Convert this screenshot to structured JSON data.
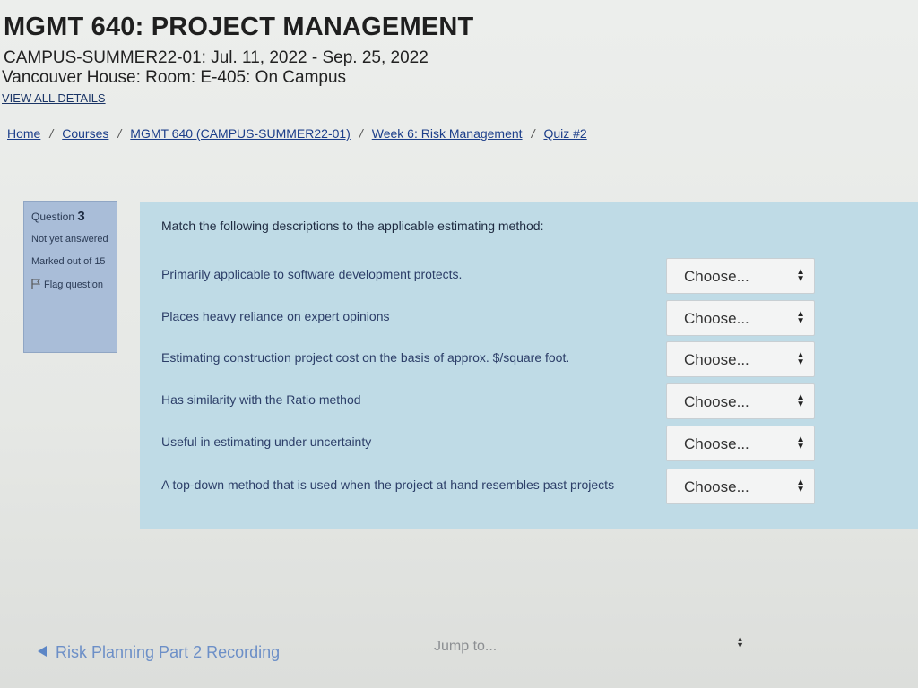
{
  "header": {
    "course_title": "MGMT 640: PROJECT MANAGEMENT",
    "session": "CAMPUS-SUMMER22-01: Jul. 11, 2022 - Sep. 25, 2022",
    "location": "Vancouver House: Room: E-405: On Campus",
    "view_details": "VIEW ALL DETAILS"
  },
  "breadcrumb": {
    "items": [
      "Home",
      "Courses",
      "MGMT 640 (CAMPUS-SUMMER22-01)",
      "Week 6: Risk Management",
      "Quiz #2"
    ],
    "separator": "/"
  },
  "question_info": {
    "label": "Question",
    "number": "3",
    "state": "Not yet answered",
    "grade": "Marked out of 15",
    "flag": "Flag question",
    "flag_icon": "flag-icon"
  },
  "question": {
    "prompt": "Match the following descriptions to the applicable estimating method:",
    "rows": [
      {
        "description": "Primarily applicable to software development protects.",
        "selected": "Choose..."
      },
      {
        "description": "Places heavy reliance on expert opinions",
        "selected": "Choose..."
      },
      {
        "description": "Estimating construction project cost on the basis of approx. $/square foot.",
        "selected": "Choose..."
      },
      {
        "description": "Has similarity with the Ratio method",
        "selected": "Choose..."
      },
      {
        "description": "Useful in estimating under uncertainty",
        "selected": "Choose..."
      },
      {
        "description": "A top-down method that is used when the project at hand resembles past projects",
        "selected": "Choose..."
      }
    ]
  },
  "footer": {
    "prev_link": "Risk Planning Part 2 Recording",
    "jump_to": "Jump to..."
  },
  "colors": {
    "question_bg": "#bfdbe6",
    "info_bg": "#a9bdd8",
    "link": "#1c3e8a"
  }
}
